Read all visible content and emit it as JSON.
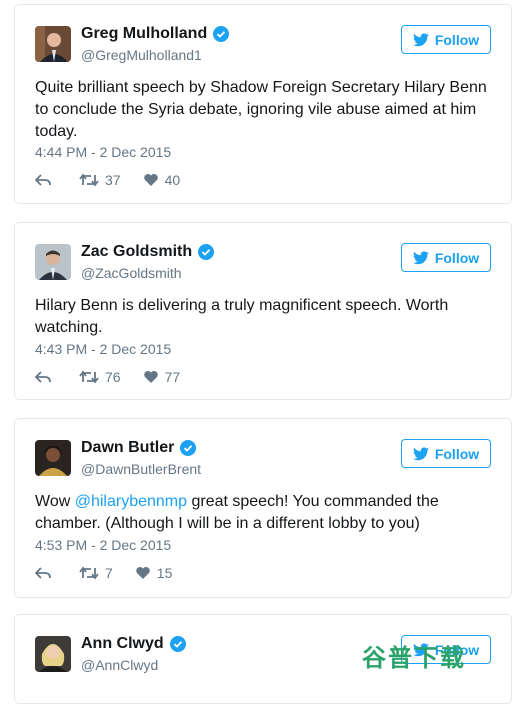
{
  "tweets": [
    {
      "name": "Greg Mulholland",
      "handle": "@GregMulholland1",
      "follow_label": "Follow",
      "text": "Quite brilliant speech by Shadow Foreign Secretary Hilary Benn to conclude the Syria debate, ignoring vile abuse aimed at him today.",
      "time": "4:44 PM - 2 Dec 2015",
      "retweets": "37",
      "likes": "40"
    },
    {
      "name": "Zac Goldsmith",
      "handle": "@ZacGoldsmith",
      "follow_label": "Follow",
      "text": "Hilary Benn is delivering a truly magnificent speech. Worth watching.",
      "time": "4:43 PM - 2 Dec 2015",
      "retweets": "76",
      "likes": "77"
    },
    {
      "name": "Dawn Butler",
      "handle": "@DawnButlerBrent",
      "follow_label": "Follow",
      "text_pre": "Wow ",
      "text_mention": "@hilarybennmp",
      "text_post": " great speech! You commanded the chamber. (Although I will be in a different lobby to you)",
      "time": "4:53 PM - 2 Dec 2015",
      "retweets": "7",
      "likes": "15"
    },
    {
      "name": "Ann Clwyd",
      "handle": "@AnnClwyd",
      "follow_label": "Follow"
    }
  ],
  "watermark": "谷普下载",
  "colors": {
    "accent": "#1da1f2",
    "meta": "#657786",
    "border": "#e1e8ed"
  },
  "icons": [
    "verified-badge-icon",
    "twitter-bird-icon",
    "reply-icon",
    "retweet-icon",
    "like-heart-icon"
  ]
}
